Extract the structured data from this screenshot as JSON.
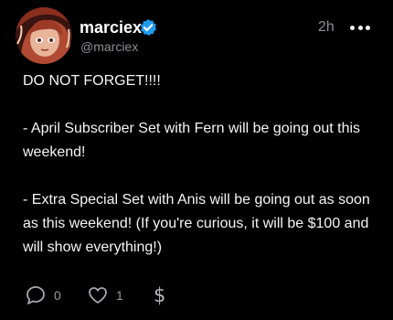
{
  "post": {
    "display_name": "marciex",
    "handle": "@marciex",
    "timestamp": "2h",
    "verified": true,
    "body": {
      "line1": "DO NOT FORGET!!!!",
      "line2": "- April Subscriber Set with Fern will be going out this weekend!",
      "line3": "- Extra Special Set with Anis will be going out as soon as this weekend! (If you're curious, it will be $100 and will show everything!)"
    },
    "actions": {
      "comments_count": "0",
      "likes_count": "1",
      "tip_symbol": "$"
    }
  },
  "icons": {
    "verified": "verified-check-badge-icon",
    "more": "more-horizontal-icon",
    "comment": "comment-bubble-icon",
    "like": "heart-icon",
    "tip": "dollar-tip-icon"
  },
  "colors": {
    "background": "#000000",
    "text": "#ffffff",
    "muted": "#8e8e93",
    "verified_blue": "#1d9bf0"
  }
}
